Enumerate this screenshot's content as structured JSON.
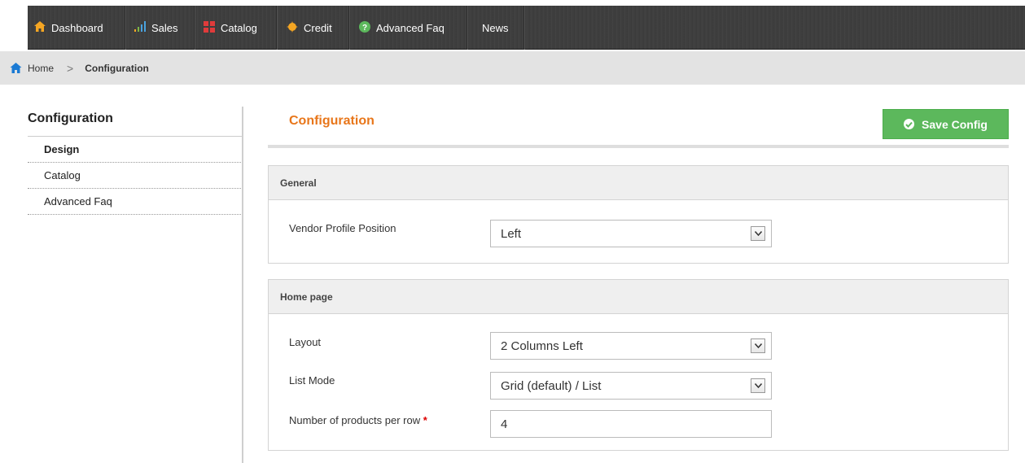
{
  "nav": {
    "items": [
      {
        "label": "Dashboard",
        "icon": "home-icon"
      },
      {
        "label": "Sales",
        "icon": "bar-chart-icon"
      },
      {
        "label": "Catalog",
        "icon": "catalog-icon"
      },
      {
        "label": "Credit",
        "icon": "credit-icon"
      },
      {
        "label": "Advanced Faq",
        "icon": "help-icon"
      },
      {
        "label": "News",
        "icon": ""
      }
    ]
  },
  "breadcrumb": {
    "home": "Home",
    "separator": ">",
    "current": "Configuration"
  },
  "sidebar": {
    "title": "Configuration",
    "items": [
      {
        "label": "Design",
        "active": true
      },
      {
        "label": "Catalog",
        "active": false
      },
      {
        "label": "Advanced Faq",
        "active": false
      }
    ]
  },
  "main": {
    "title": "Configuration",
    "save_label": "Save Config"
  },
  "general": {
    "title": "General",
    "vendor_profile_position_label": "Vendor Profile Position",
    "vendor_profile_position_value": "Left"
  },
  "home_page": {
    "title": "Home page",
    "layout_label": "Layout",
    "layout_value": "2 Columns Left",
    "list_mode_label": "List Mode",
    "list_mode_value": "Grid (default) / List",
    "products_per_row_label": "Number of products per row",
    "products_per_row_required": "*",
    "products_per_row_value": "4"
  },
  "colors": {
    "accent": "#e8761a",
    "save_button": "#5cb85c",
    "nav_background": "#3c3c3c",
    "link_blue": "#1a7ad4"
  }
}
